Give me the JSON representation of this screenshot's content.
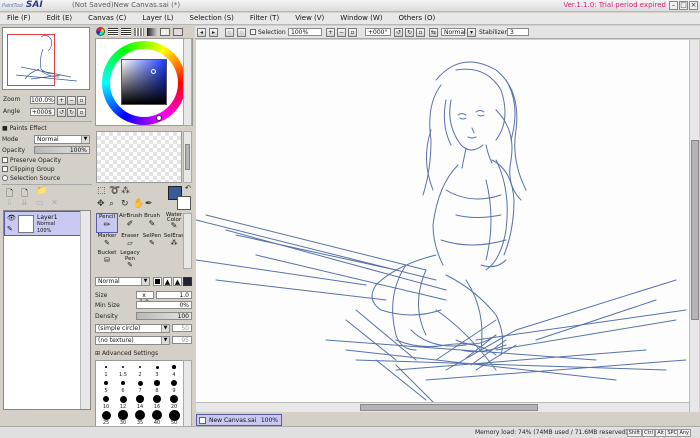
{
  "app": {
    "logo_small": "PaintTool",
    "logo": "SAI",
    "doc_title": "(Not Saved)New Canvas.sai (*)",
    "version": "Ver.1.1.0: Trial period expired"
  },
  "menu": [
    {
      "label": "File (F)"
    },
    {
      "label": "Edit (E)"
    },
    {
      "label": "Canvas (C)"
    },
    {
      "label": "Layer (L)"
    },
    {
      "label": "Selection (S)"
    },
    {
      "label": "Filter (T)"
    },
    {
      "label": "View (V)"
    },
    {
      "label": "Window (W)"
    },
    {
      "label": "Others (O)"
    }
  ],
  "navigator": {
    "zoom_label": "Zoom",
    "zoom_value": "100.0%",
    "angle_label": "Angle",
    "angle_value": "+000$"
  },
  "paints_effect": {
    "header": "Paints Effect",
    "mode_label": "Mode",
    "mode_value": "Normal",
    "opacity_label": "Opacity",
    "opacity_value": "100%",
    "preserve_opacity": "Preserve Opacity",
    "clipping_group": "Clipping Group",
    "selection_source": "Selection Source"
  },
  "layer": {
    "name": "Layer1",
    "mode": "Normal",
    "opacity": "100%"
  },
  "colors": {
    "foreground": "#3a5a9a",
    "background": "#ffffff",
    "accent_selection": "#c8c8f0",
    "sketch_line": "#3b5a9c"
  },
  "tools": {
    "row1": [
      "Pencil",
      "AirBrush",
      "Brush",
      "Water Color"
    ],
    "row2": [
      "Marker",
      "Eraser",
      "SelPen",
      "SelEras"
    ],
    "row3": [
      "Bucket",
      "Legacy Pen"
    ],
    "selected": "Pencil"
  },
  "brush_settings": {
    "blend_mode": "Normal",
    "size_label": "Size",
    "size_multiplier": "x 1.0",
    "size_value": "1.0",
    "min_size_label": "Min Size",
    "min_size_value": "0%",
    "density_label": "Density",
    "density_value": "100",
    "shape": "(simple circle)",
    "shape_value": "50",
    "texture": "(no texture)",
    "texture_value": "95",
    "advanced": "Advanced Settings"
  },
  "brush_sizes": [
    "1",
    "1.5",
    "2",
    "3",
    "4",
    "5",
    "6",
    "7",
    "8",
    "9",
    "10",
    "12",
    "14",
    "16",
    "20",
    "25",
    "30",
    "35",
    "40",
    "50"
  ],
  "canvas_toolbar": {
    "selection_label": "Selection",
    "zoom_value": "100%",
    "angle_value": "+000°",
    "blend_mode": "Normal",
    "stabilizer_label": "Stabilizer",
    "stabilizer_value": "3"
  },
  "document_tab": {
    "name": "New Canvas.sai",
    "zoom": "100%"
  },
  "status": {
    "memory": "Memory load: 74% (74MB used / 71.6MB reserved)",
    "buttons": [
      "Shift",
      "Ctrl",
      "Alt",
      "SPC",
      "Any"
    ]
  }
}
